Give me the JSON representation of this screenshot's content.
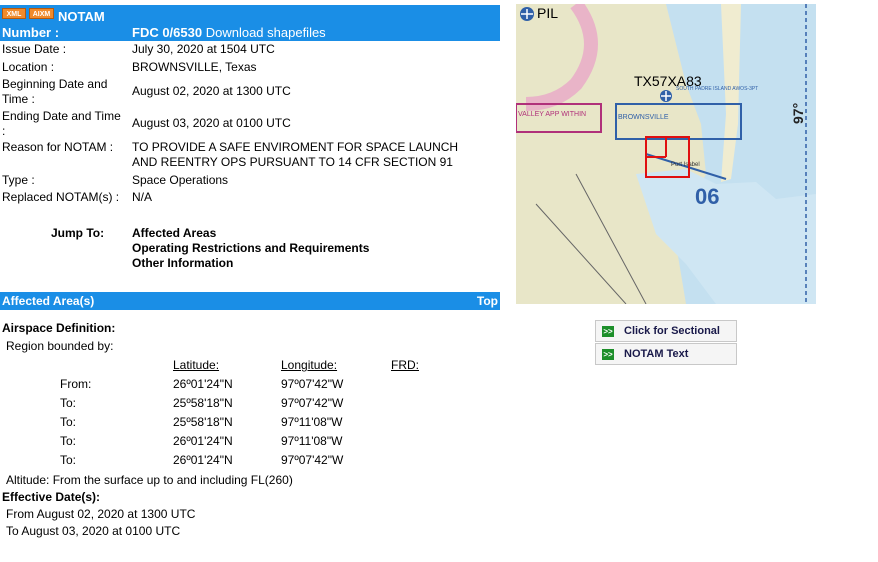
{
  "header": {
    "badge_xml": "XML",
    "badge_aixm": "AIXM",
    "title": "NOTAM",
    "number_label": "Number :",
    "number_value": "FDC 0/6530",
    "download_link": "Download shapefiles"
  },
  "details": [
    {
      "label": "Issue Date :",
      "value": "July 30, 2020 at 1504 UTC"
    },
    {
      "label": "Location :",
      "value": "BROWNSVILLE, Texas"
    },
    {
      "label_line1": "Beginning Date and",
      "label_line2": "Time :",
      "value": "August 02, 2020 at 1300 UTC"
    },
    {
      "label_line1": "Ending Date and Time",
      "label_line2": ":",
      "value": "August 03, 2020 at 0100 UTC"
    },
    {
      "label": "Reason for NOTAM :",
      "value_line1": "TO PROVIDE A SAFE ENVIROMENT FOR SPACE LAUNCH",
      "value_line2": "AND REENTRY OPS PURSUANT TO 14 CFR SECTION 91"
    },
    {
      "label": "Type :",
      "value": "Space Operations"
    },
    {
      "label": "Replaced NOTAM(s) :",
      "value": "N/A"
    }
  ],
  "jump": {
    "label": "Jump To:",
    "links": [
      "Affected Areas",
      "Operating Restrictions and Requirements",
      "Other Information"
    ]
  },
  "affected": {
    "title": "Affected Area(s)",
    "top_link": "Top",
    "airspace_def": "Airspace Definition:",
    "region": "Region bounded by:",
    "columns": [
      "Latitude:",
      "Longitude:",
      "FRD:"
    ],
    "rows": [
      {
        "label": "From:",
        "lat": "26º01'24\"N",
        "lon": "97º07'42\"W"
      },
      {
        "label": "To:",
        "lat": "25º58'18\"N",
        "lon": "97º07'42\"W"
      },
      {
        "label": "To:",
        "lat": "25º58'18\"N",
        "lon": "97º11'08\"W"
      },
      {
        "label": "To:",
        "lat": "26º01'24\"N",
        "lon": "97º11'08\"W"
      },
      {
        "label": "To:",
        "lat": "26º01'24\"N",
        "lon": "97º07'42\"W"
      }
    ],
    "altitude": "Altitude: From the surface up to and including FL(260)",
    "effective_label": "Effective Date(s):",
    "effective_from": "From August 02, 2020 at 1300 UTC",
    "effective_to": "To August 03, 2020 at 0100 UTC"
  },
  "map": {
    "label_pil": "PIL",
    "label_tx": "TX57XA83",
    "label_brownsville": "BROWNSVILLE",
    "label_spi": "SOUTH PADRE ISLAND AWOS-3PT",
    "label_valley": "VALLEY APP WITHIN",
    "label_06": "06",
    "label_97": "97°",
    "label_port": "Port Isabel",
    "accent_red": "#e01010",
    "water": "#c4e0f0",
    "land": "#e8e6c8"
  },
  "buttons": {
    "sectional": "Click for Sectional",
    "notam_text": "NOTAM Text",
    "arrow": ">>"
  }
}
